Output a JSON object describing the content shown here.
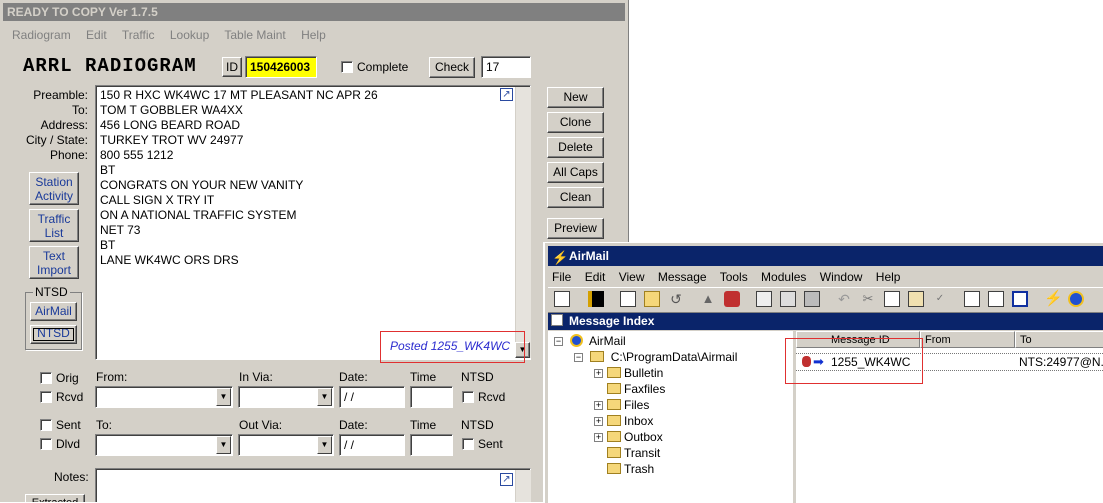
{
  "app": {
    "title": "READY TO COPY Ver 1.7.5",
    "menu": [
      "Radiogram",
      "Edit",
      "Traffic",
      "Lookup",
      "Table Maint",
      "Help"
    ]
  },
  "form": {
    "heading": "ARRL RADIOGRAM",
    "id_label": "ID",
    "id_value": "150426003",
    "complete_label": "Complete",
    "check_label": "Check",
    "check_value": "17",
    "labels": {
      "preamble": "Preamble:",
      "to": "To:",
      "address": "Address:",
      "city_state": "City / State:",
      "phone": "Phone:"
    },
    "message_lines": [
      "150 R HXC WK4WC 17 MT PLEASANT NC APR 26",
      "TOM T GOBBLER WA4XX",
      "456 LONG BEARD ROAD",
      "TURKEY TROT WV 24977",
      "800 555 1212",
      "BT",
      "CONGRATS ON YOUR NEW VANITY",
      "CALL SIGN X TRY IT",
      "ON A NATIONAL TRAFFIC SYSTEM",
      "NET 73",
      "BT",
      "LANE WK4WC ORS DRS"
    ],
    "posted_text": "Posted 1255_WK4WC"
  },
  "left_buttons": {
    "station_activity": [
      "Station",
      "Activity"
    ],
    "traffic_list": [
      "Traffic",
      "List"
    ],
    "text_import": [
      "Text",
      "Import"
    ],
    "ntsd_group": "NTSD",
    "airmail": "AirMail",
    "ntsd": "NTSD"
  },
  "right_buttons": [
    "New",
    "Clone",
    "Delete",
    "All Caps",
    "Clean",
    "Preview"
  ],
  "handling": {
    "orig": "Orig",
    "rcvd": "Rcvd",
    "sent": "Sent",
    "dlvd": "Dlvd",
    "from": "From:",
    "in_via": "In Via:",
    "date": "Date:",
    "time": "Time",
    "ntsd": "NTSD",
    "ntsd_rcvd": "Rcvd",
    "to": "To:",
    "out_via": "Out Via:",
    "date2": "Date:",
    "time2": "Time",
    "ntsd2": "NTSD",
    "ntsd_sent": "Sent",
    "date_value": " / /",
    "date_value2": " / /"
  },
  "notes": {
    "label": "Notes:",
    "extracted_button": "Extracted"
  },
  "airmail": {
    "title": "AirMail",
    "menu": [
      "File",
      "Edit",
      "View",
      "Message",
      "Tools",
      "Modules",
      "Window",
      "Help"
    ],
    "index_title": "Message Index",
    "tree": {
      "root": "AirMail",
      "path": "C:\\ProgramData\\Airmail",
      "folders": [
        "Bulletin",
        "Faxfiles",
        "Files",
        "Inbox",
        "Outbox",
        "Transit",
        "Trash"
      ]
    },
    "columns": [
      "Message ID",
      "From",
      "To"
    ],
    "rows": [
      {
        "id": "1255_WK4WC",
        "from": "",
        "to": "NTS:24977@N..."
      }
    ]
  },
  "colors": {
    "id_highlight": "#ffff00",
    "posted_text": "#2b2bcf",
    "annotation_box": "#e03030",
    "airmail_title": "#0a246a"
  }
}
